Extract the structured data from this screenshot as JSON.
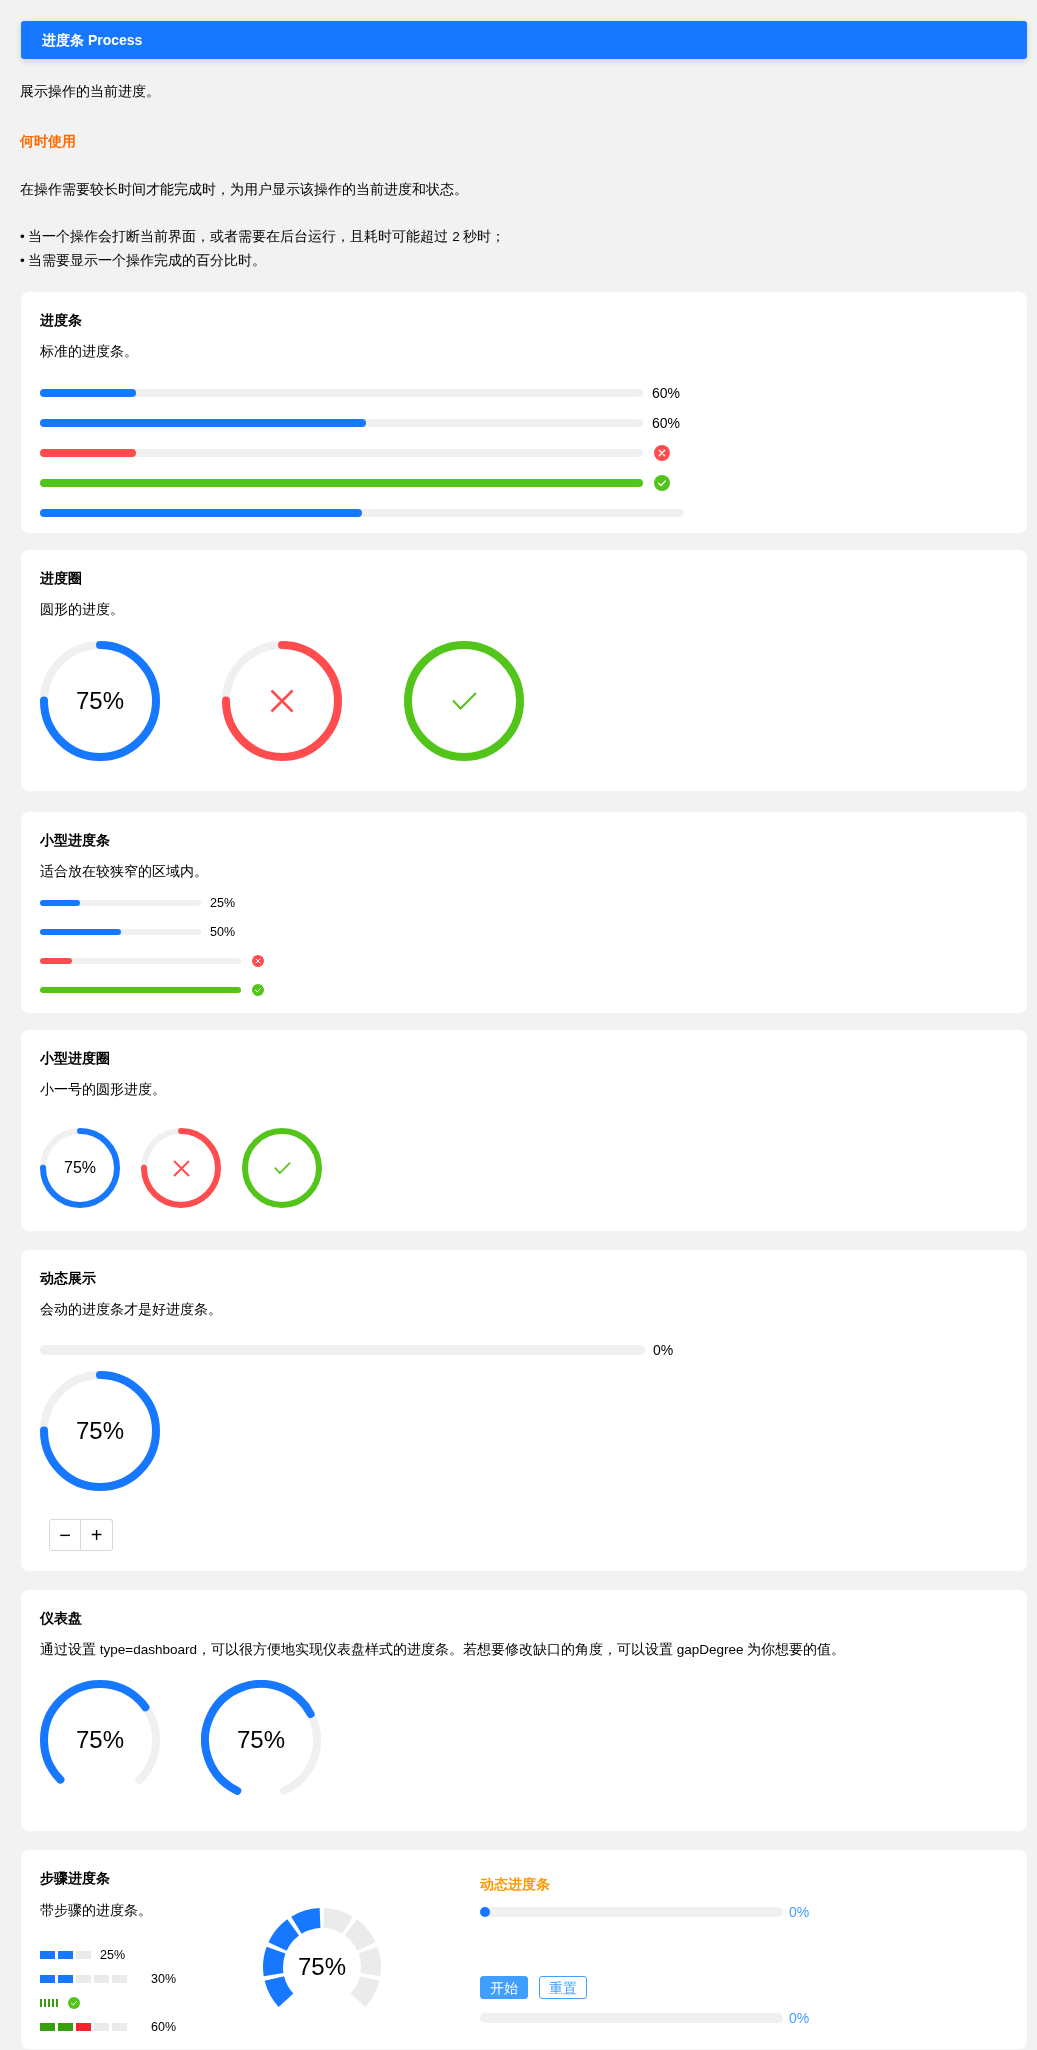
{
  "header": {
    "title": "进度条 Process"
  },
  "intro": {
    "summary": "展示操作的当前进度。",
    "heading": "何时使用",
    "paragraph": "在操作需要较长时间才能完成时，为用户显示该操作的当前进度和状态。",
    "bullets": [
      "• 当一个操作会打断当前界面，或者需要在后台运行，且耗时可能超过 2 秒时；",
      "• 当需要显示一个操作完成的百分比时。"
    ]
  },
  "cards": [
    {
      "kind": "lines",
      "title": "进度条",
      "description": "标准的进度条。",
      "items": [
        {
          "level": 0.16,
          "kind": "normal",
          "info": "60%"
        },
        {
          "level": 0.54,
          "kind": "normal",
          "info": "60%"
        },
        {
          "level": 0.16,
          "kind": "exception"
        },
        {
          "level": 1,
          "kind": "success"
        },
        {
          "level": 0.5,
          "kind": "normal"
        }
      ]
    },
    {
      "kind": "circles",
      "title": "进度圈",
      "description": "圆形的进度。",
      "items": [
        {
          "level": 0.75,
          "kind": "normal",
          "info": "75%"
        },
        {
          "level": 0.75,
          "kind": "exception"
        },
        {
          "level": 1,
          "kind": "success"
        }
      ]
    },
    {
      "kind": "small_lines",
      "title": "小型进度条",
      "description": "适合放在较狭窄的区域内。",
      "items": [
        {
          "level": 0.25,
          "kind": "normal",
          "info": "25%"
        },
        {
          "level": 0.5,
          "kind": "normal",
          "info": "50%"
        },
        {
          "level": 0.16,
          "kind": "exception"
        },
        {
          "level": 1,
          "kind": "success"
        }
      ]
    },
    {
      "kind": "small_circles",
      "title": "小型进度圈",
      "description": "小一号的圆形进度。",
      "items": [
        {
          "level": 0.75,
          "kind": "normal",
          "info": "75%"
        },
        {
          "level": 0.75,
          "kind": "exception"
        },
        {
          "level": 1,
          "kind": "success"
        }
      ]
    },
    {
      "kind": "dynamic",
      "title": "动态展示",
      "description": "会动的进度条才是好进度条。",
      "line": {
        "level": 0,
        "info": "0%"
      },
      "circle": {
        "level": 0.75,
        "kind": "normal",
        "info": "75%"
      },
      "buttons": [
        {
          "label": "−"
        },
        {
          "label": "+"
        }
      ]
    },
    {
      "kind": "dashboards",
      "title": "仪表盘",
      "description": "通过设置 type=dashboard，可以很方便地实现仪表盘样式的进度条。若想要修改缺口的角度，可以设置 gapDegree 为你想要的值。",
      "items": [
        {
          "level": 0.7,
          "info": "75%",
          "kind": "wide_gap"
        },
        {
          "level": 0.7,
          "info": "75%",
          "kind": "narrow_gap"
        }
      ]
    },
    {
      "kind": "steps",
      "title": "步骤进度条",
      "description": "带步骤的进度条。",
      "rows": [
        {
          "kind": "blocks",
          "steps": [
            {
              "color": "#1677ff"
            },
            {
              "color": "#1677ff"
            },
            {
              "color": "#ebebeb"
            }
          ],
          "info": "25%"
        },
        {
          "kind": "blocks",
          "steps": [
            {
              "color": "#1677ff"
            },
            {
              "color": "#1677ff"
            },
            {
              "color": "#ebebeb"
            },
            {
              "color": "#ebebeb"
            },
            {
              "color": "#ebebeb"
            }
          ],
          "info": "30%"
        },
        {
          "kind": "ticks",
          "steps": [
            {
              "color": "#389e0d"
            },
            {
              "color": "#389e0d"
            },
            {
              "color": "#389e0d"
            },
            {
              "color": "#389e0d"
            },
            {
              "color": "#389e0d"
            }
          ]
        },
        {
          "kind": "blocks",
          "steps": [
            {
              "color": "#389e0d"
            },
            {
              "color": "#389e0d"
            },
            {
              "color": "#f5222d"
            },
            {
              "color": "#ebebeb"
            },
            {
              "color": "#ebebeb"
            }
          ],
          "info": "60%"
        }
      ],
      "ring": {
        "info": "75%",
        "segments": [
          {
            "color": "#1677ff"
          },
          {
            "color": "#1677ff"
          },
          {
            "color": "#1677ff"
          },
          {
            "color": "#1677ff"
          },
          {
            "color": "#ebebeb"
          },
          {
            "color": "#ebebeb"
          },
          {
            "color": "#ebebeb"
          },
          {
            "color": "#ebebeb"
          }
        ]
      },
      "live": {
        "title": "动态进度条",
        "upper_bar": {
          "level": 0.033,
          "info": "0%"
        },
        "buttons": [
          {
            "label": "开始",
            "kind": "primary"
          },
          {
            "label": "重置",
            "kind": "plain"
          }
        ],
        "lower_bar": {
          "level": 0,
          "info": "0%"
        }
      }
    }
  ]
}
